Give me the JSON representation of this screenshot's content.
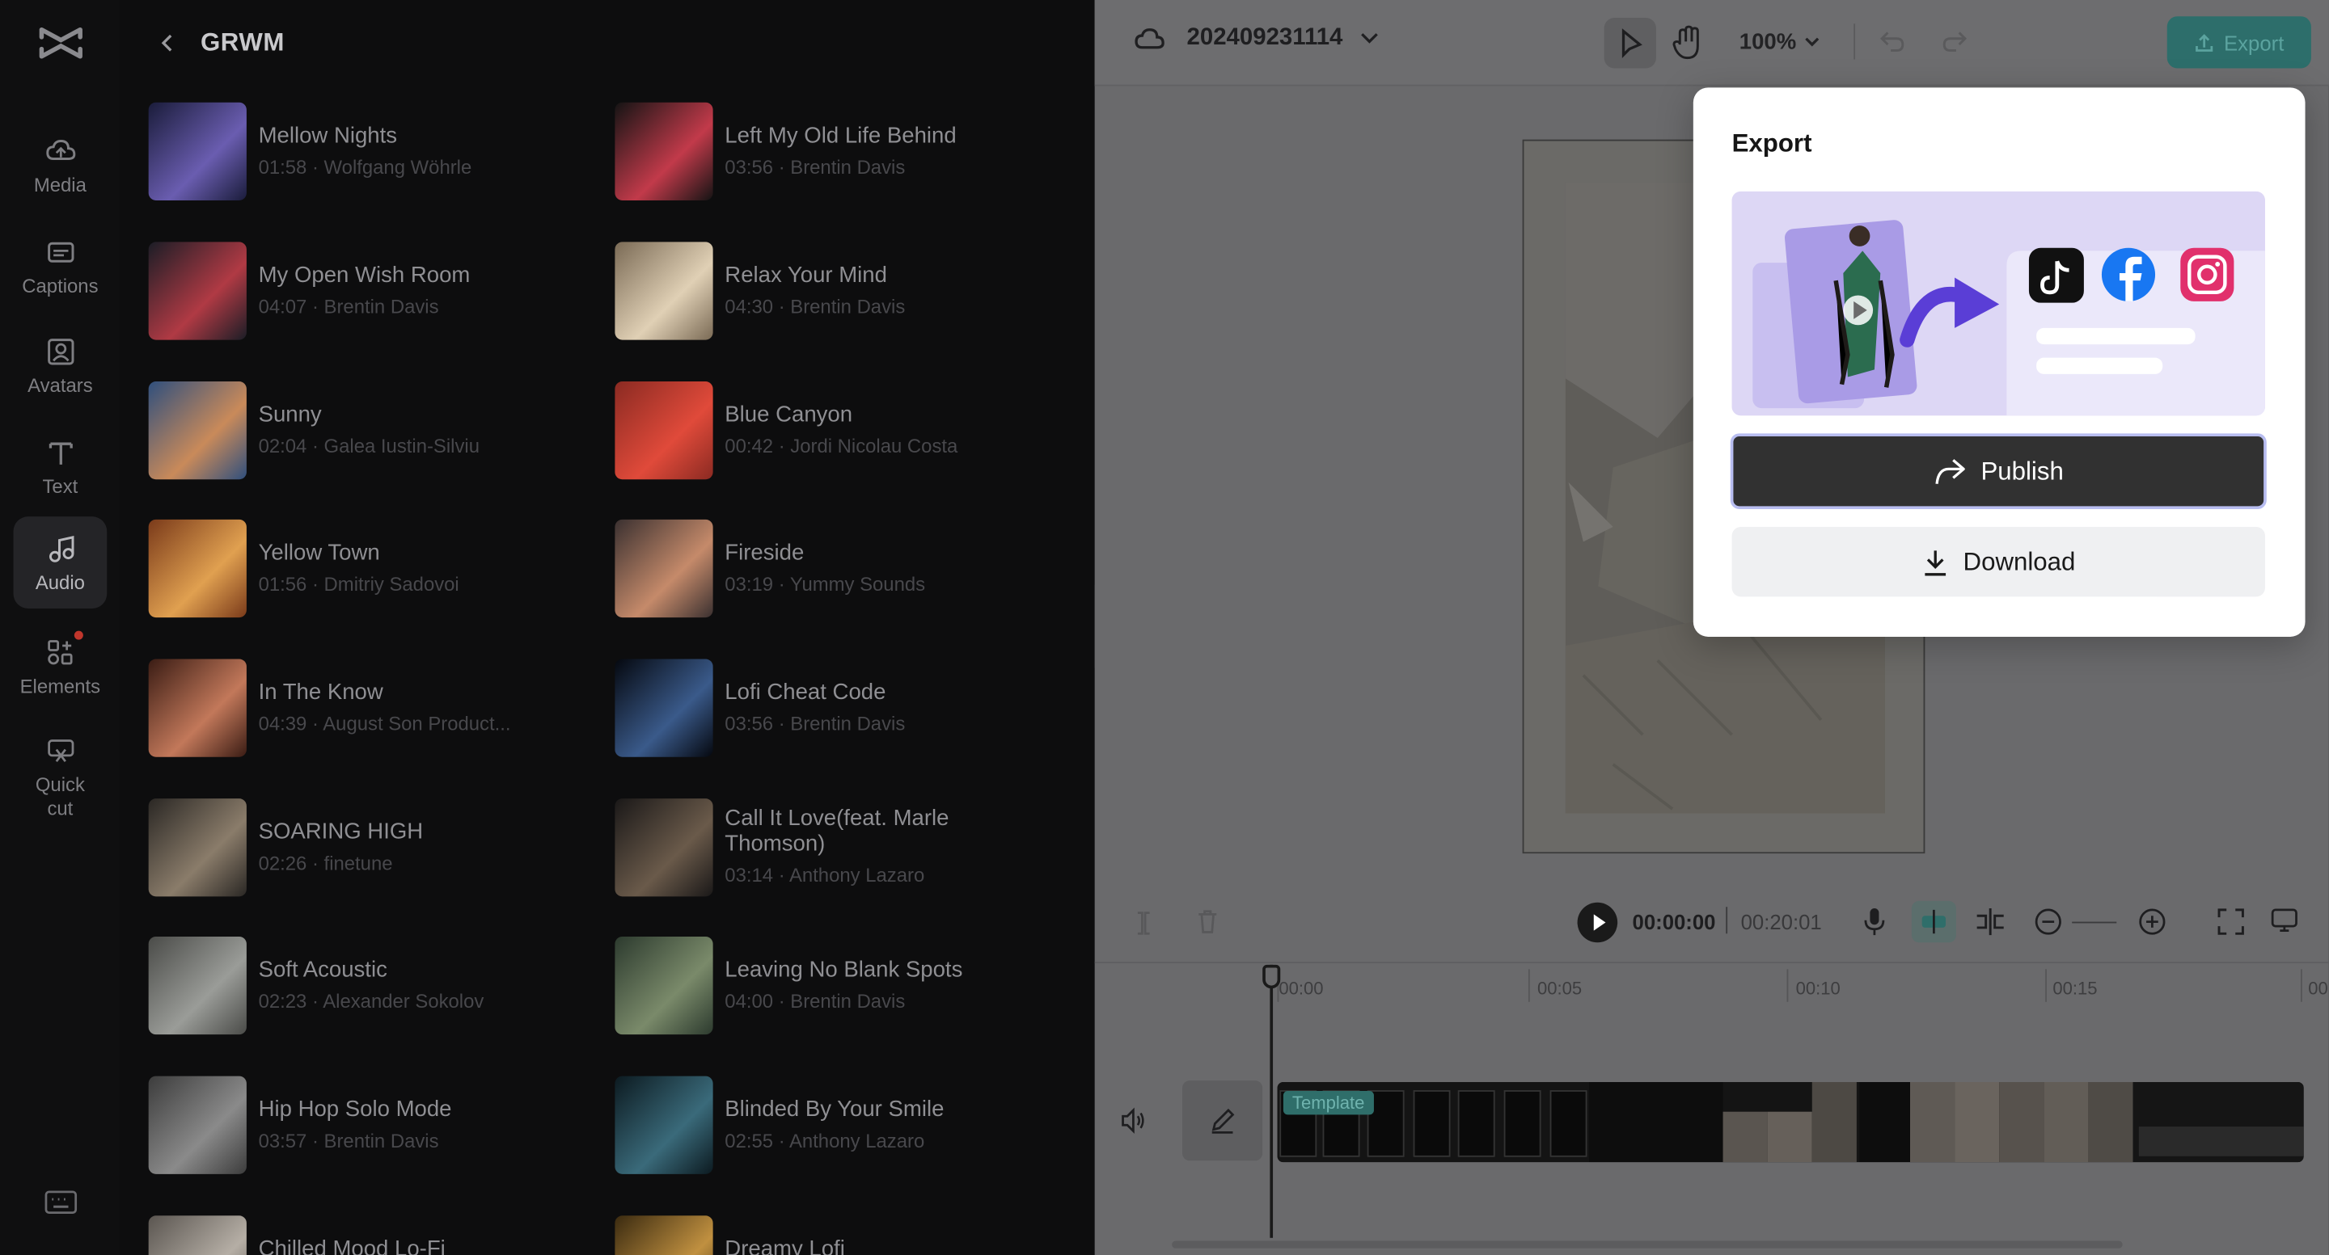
{
  "sidebar": {
    "items": [
      {
        "label": "Media",
        "icon": "cloud-media-icon"
      },
      {
        "label": "Captions",
        "icon": "captions-icon"
      },
      {
        "label": "Avatars",
        "icon": "avatar-icon"
      },
      {
        "label": "Text",
        "icon": "text-icon"
      },
      {
        "label": "Audio",
        "icon": "music-note-icon"
      },
      {
        "label": "Elements",
        "icon": "elements-icon"
      },
      {
        "label": "Quick cut",
        "icon": "quick-cut-icon"
      }
    ],
    "active": "Audio"
  },
  "audio_panel": {
    "title": "GRWM",
    "tracks_left": [
      {
        "title": "Mellow Nights",
        "meta": "01:58 · Wolfgang Wöhrle"
      },
      {
        "title": "My Open Wish Room",
        "meta": "04:07 · Brentin Davis"
      },
      {
        "title": "Sunny",
        "meta": "02:04 · Galea Iustin-Silviu"
      },
      {
        "title": "Yellow Town",
        "meta": "01:56 · Dmitriy Sadovoi"
      },
      {
        "title": "In The Know",
        "meta": "04:39 · August Son Product..."
      },
      {
        "title": "SOARING HIGH",
        "meta": "02:26 · finetune"
      },
      {
        "title": "Soft Acoustic",
        "meta": "02:23 · Alexander Sokolov"
      },
      {
        "title": "Hip Hop Solo Mode",
        "meta": "03:57 · Brentin Davis"
      },
      {
        "title": "Chilled Mood Lo-Fi",
        "meta": ""
      }
    ],
    "tracks_right": [
      {
        "title": "Left My Old Life Behind",
        "meta": "03:56 · Brentin Davis"
      },
      {
        "title": "Relax Your Mind",
        "meta": "04:30 · Brentin Davis"
      },
      {
        "title": "Blue Canyon",
        "meta": "00:42 · Jordi Nicolau Costa"
      },
      {
        "title": "Fireside",
        "meta": "03:19 · Yummy Sounds"
      },
      {
        "title": "Lofi Cheat Code",
        "meta": "03:56 · Brentin Davis"
      },
      {
        "title": "Call It Love(feat. Marle Thomson)",
        "meta": "03:14 · Anthony Lazaro"
      },
      {
        "title": "Leaving No Blank Spots",
        "meta": "04:00 · Brentin Davis"
      },
      {
        "title": "Blinded By Your Smile",
        "meta": "02:55 · Anthony Lazaro"
      },
      {
        "title": "Dreamy Lofi",
        "meta": ""
      }
    ]
  },
  "topbar": {
    "project_name": "202409231114",
    "zoom": "100%",
    "export_label": "Export"
  },
  "player": {
    "current_time": "00:00:00",
    "total_time": "00:20:01"
  },
  "timeline": {
    "ticks": [
      "00:00",
      "00:05",
      "00:10",
      "00:15",
      "00"
    ],
    "template_label": "Template"
  },
  "export_popover": {
    "title": "Export",
    "publish_label": "Publish",
    "download_label": "Download"
  },
  "colors": {
    "accent": "#2d6e6b",
    "publish_bg": "#313131",
    "illustration_bg": "#ded8f6"
  }
}
